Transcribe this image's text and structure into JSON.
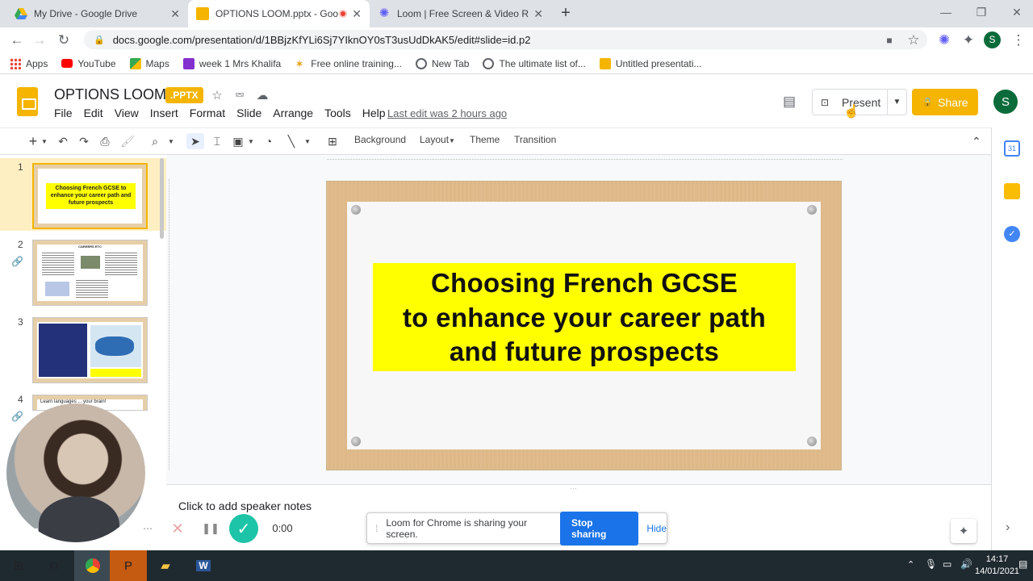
{
  "browser": {
    "tabs": [
      {
        "title": "My Drive - Google Drive",
        "icon": "google-drive-icon"
      },
      {
        "title": "OPTIONS LOOM.pptx - Goo",
        "icon": "google-slides-icon",
        "active": true
      },
      {
        "title": "Loom | Free Screen & Video Rec",
        "icon": "loom-icon"
      }
    ],
    "new_tab": "+",
    "url": "docs.google.com/presentation/d/1BBjzKfYLi6Sj7YIknOY0sT3usUdDkAK5/edit#slide=id.p2",
    "profile_initial": "S",
    "bookmarks": [
      {
        "label": "Apps",
        "icon": "apps-grid-icon"
      },
      {
        "label": "YouTube",
        "icon": "youtube-icon"
      },
      {
        "label": "Maps",
        "icon": "maps-icon"
      },
      {
        "label": "week 1 Mrs Khalifa",
        "icon": "classroom-icon"
      },
      {
        "label": "Free online training...",
        "icon": "star-bookmark-icon"
      },
      {
        "label": "New Tab",
        "icon": "globe-icon"
      },
      {
        "label": "The ultimate list of...",
        "icon": "globe-icon"
      },
      {
        "label": "Untitled presentati...",
        "icon": "google-slides-icon"
      }
    ]
  },
  "app": {
    "doc_title": "OPTIONS LOOM",
    "file_badge": ".PPTX",
    "menu": [
      "File",
      "Edit",
      "View",
      "Insert",
      "Format",
      "Slide",
      "Arrange",
      "Tools",
      "Help"
    ],
    "last_edit": "Last edit was 2 hours ago",
    "present_label": "Present",
    "share_label": "Share",
    "avatar_initial": "S"
  },
  "toolbar": {
    "background": "Background",
    "layout": "Layout",
    "theme": "Theme",
    "transition": "Transition"
  },
  "filmstrip": {
    "slides": [
      {
        "number": "1",
        "thumb_text": "Choosing French GCSE to enhance your career path and future prospects"
      },
      {
        "number": "2",
        "thumb_text": "CAREERS ETC"
      },
      {
        "number": "3",
        "thumb_text": ""
      },
      {
        "number": "4",
        "thumb_text": "Learn languages ... your brain!"
      }
    ]
  },
  "slide": {
    "title_lines": [
      "Choosing French GCSE",
      "to enhance your career path",
      "and future prospects"
    ]
  },
  "notes_placeholder": "Click to add speaker notes",
  "loom": {
    "message": "Loom for Chrome is sharing your screen.",
    "stop_label": "Stop sharing",
    "hide_label": "Hide",
    "timer": "0:00"
  },
  "taskbar": {
    "time": "14:17",
    "date": "14/01/2021"
  },
  "colors": {
    "slides_yellow": "#f4b400",
    "title_highlight": "#ffff00",
    "loom_blue": "#1a73e8",
    "loom_green": "#1dc4a7"
  }
}
